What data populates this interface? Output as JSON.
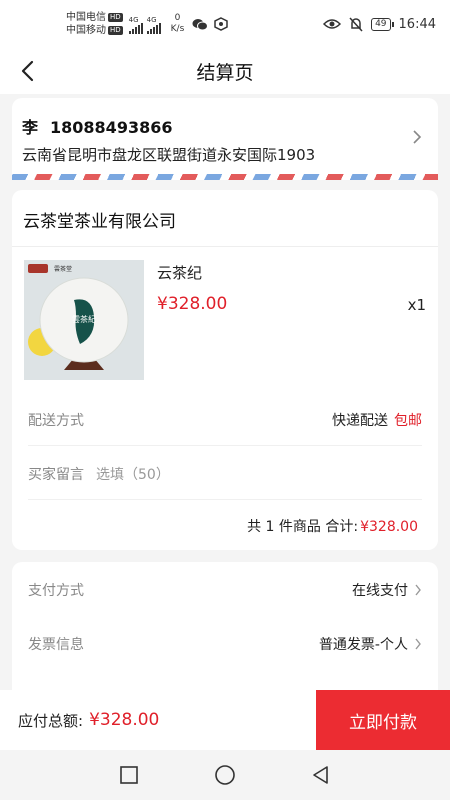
{
  "status_bar": {
    "carrier1": "中国电信",
    "carrier2": "中国移动",
    "hd": "HD",
    "sig1": "4G",
    "sig2": "4G",
    "net_speed_value": "0",
    "net_speed_unit": "K/s",
    "battery": "49",
    "time": "16:44"
  },
  "header": {
    "title": "结算页"
  },
  "address": {
    "name": "李",
    "phone": "18088493866",
    "detail": "云南省昆明市盘龙区联盟街道永安国际1903"
  },
  "shop": {
    "name": "云茶堂茶业有限公司"
  },
  "product": {
    "name": "云茶纪",
    "price": "¥328.00",
    "qty": "x1",
    "brand_text": "雲茶堂",
    "tea_label": "雲茶紀"
  },
  "delivery": {
    "label": "配送方式",
    "method": "快递配送",
    "fee": "包邮"
  },
  "message": {
    "label": "买家留言",
    "placeholder": "选填（50）"
  },
  "summary": {
    "text": "共 1 件商品 合计:",
    "amount": "¥328.00"
  },
  "payment": {
    "label": "支付方式",
    "value": "在线支付"
  },
  "invoice": {
    "label": "发票信息",
    "value": "普通发票-个人"
  },
  "bottom": {
    "total_label": "应付总额:",
    "total_amount": "¥328.00",
    "pay_button": "立即付款"
  },
  "colors": {
    "accent": "#e0202a",
    "pay_button": "#ec2c32",
    "airmail_red": "#e35b5b",
    "airmail_blue": "#7aa7e0"
  }
}
